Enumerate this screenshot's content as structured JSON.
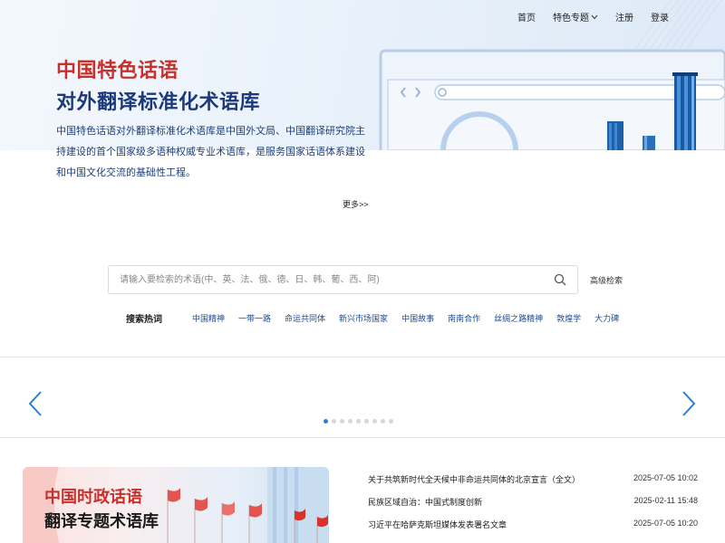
{
  "nav": {
    "items": [
      {
        "label": "首页"
      },
      {
        "label": "特色专题"
      },
      {
        "label": "注册"
      },
      {
        "label": "登录"
      }
    ]
  },
  "hero": {
    "title_line1": "中国特色话语",
    "title_line2": "对外翻译标准化术语库",
    "description": "中国特色话语对外翻译标准化术语库是中国外文局、中国翻译研究院主持建设的首个国家级多语种权威专业术语库，是服务国家话语体系建设和中国文化交流的基础性工程。",
    "more_label": "更多>>"
  },
  "search": {
    "placeholder": "请输入要检索的术语(中、英、法、俄、德、日、韩、葡、西、阿)",
    "value": "",
    "advanced_label": "高级检索"
  },
  "hot_search": {
    "label": "搜索热词",
    "terms": [
      "中国精神",
      "一带一路",
      "命运共同体",
      "新兴市场国家",
      "中国故事",
      "南南合作",
      "丝绸之路精神",
      "敦煌学",
      "大力碑"
    ]
  },
  "carousel": {
    "slide_count": 9,
    "active_index": 0
  },
  "feature": {
    "title_line1": "中国时政话语",
    "title_line2": "翻译专题术语库"
  },
  "news": [
    {
      "title": "关于共筑新时代全天候中非命运共同体的北京宣言（全文）",
      "date": "2025-07-05 10:02"
    },
    {
      "title": "民族区域自治：中国式制度创新",
      "date": "2025-02-11 15:48"
    },
    {
      "title": "习近平在哈萨克斯坦媒体发表署名文章",
      "date": "2025-07-05 10:20"
    }
  ],
  "colors": {
    "accent_red": "#c8312b",
    "accent_navy": "#1c3a7a",
    "link_blue": "#1f4a8f",
    "active_dot": "#2d7fd6"
  },
  "icons": {
    "search": "search-icon",
    "chevron": "chevron-down-icon",
    "prev": "chevron-left-icon",
    "next": "chevron-right-icon"
  }
}
